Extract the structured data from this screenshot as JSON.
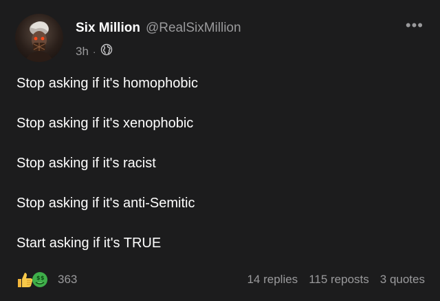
{
  "author": {
    "display_name": "Six Million",
    "handle": "@RealSixMillion"
  },
  "meta": {
    "time": "3h",
    "separator": "·",
    "visibility_icon": "globe-icon"
  },
  "more_icon_glyph": "•••",
  "body_lines": [
    "Stop asking if it's homophobic",
    "Stop asking if it's xenophobic",
    "Stop asking if it's racist",
    "Stop asking if it's anti-Semitic",
    "Start asking if it's TRUE"
  ],
  "footer": {
    "reaction_icons": [
      "thumbs-up-icon",
      "money-face-icon"
    ],
    "reaction_count": "363",
    "replies": "14 replies",
    "reposts": "115 reposts",
    "quotes": "3 quotes"
  },
  "colors": {
    "background": "#1c1c1d",
    "text": "#ffffff",
    "muted": "#9a9a9c"
  }
}
